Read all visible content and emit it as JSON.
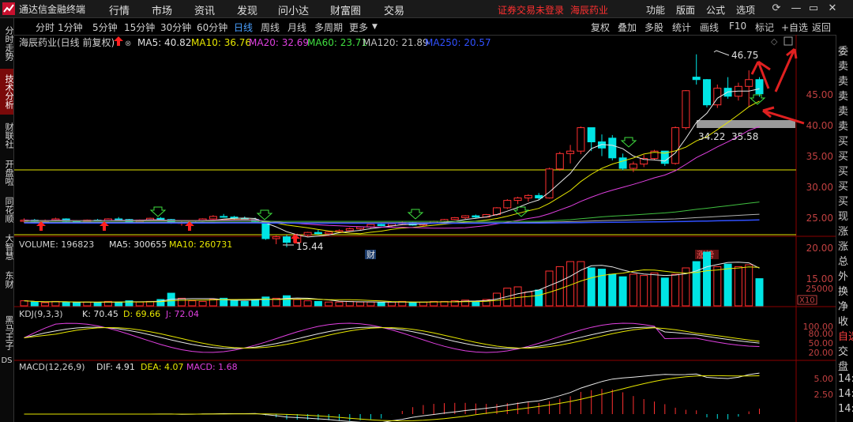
{
  "app": {
    "title": "通达信金融终端"
  },
  "menu": [
    "行情",
    "市场",
    "资讯",
    "发现",
    "问小达",
    "财富圈",
    "交易"
  ],
  "notice": {
    "login": "证券交易未登录",
    "stock": "海辰药业"
  },
  "right_menu": [
    "功能",
    "版面",
    "公式",
    "选项"
  ],
  "left_tabs": [
    "分时走势",
    "技术分析",
    "财联社",
    "开盘啦",
    "同花顺",
    "大智慧",
    "东财",
    "黑马王子",
    "DS"
  ],
  "periods": [
    "分时",
    "1分钟",
    "5分钟",
    "15分钟",
    "30分钟",
    "60分钟",
    "日线",
    "周线",
    "月线",
    "多周期",
    "更多"
  ],
  "selected_period": "日线",
  "tools": [
    "复权",
    "叠加",
    "多股",
    "统计",
    "画线",
    "F10",
    "标记",
    "+自选",
    "返回"
  ],
  "stock_header": {
    "name": "海辰药业(日线 前复权)",
    "ma5": "MA5: 40.82",
    "ma10": "MA10: 36.76",
    "ma20": "MA20: 32.69",
    "ma60": "MA60: 23.71",
    "ma120": "MA120: 21.89",
    "ma250": "MA250: 20.57"
  },
  "price_axis": [
    "45.00",
    "40.00",
    "35.00",
    "30.00",
    "25.00",
    "20.00",
    "15.00"
  ],
  "annotations": {
    "high": "46.75",
    "low": "15.44",
    "range_low": "34.22",
    "range_high": "35.58",
    "cai": "财",
    "zhangbang": "涨榜"
  },
  "volume_header": {
    "volume": "VOLUME: 196823",
    "ma5": "MA5: 300655",
    "ma10": "MA10: 260731"
  },
  "volume_axis": {
    "value": "25000",
    "unit": "X10"
  },
  "kdj_header": {
    "name": "KDJ(9,3,3)",
    "k": "K: 70.45",
    "d": "D: 69.66",
    "j": "J: 72.04"
  },
  "kdj_axis": [
    "100.00",
    "80.00",
    "50.00",
    "20.00"
  ],
  "macd_header": {
    "name": "MACD(12,26,9)",
    "dif": "DIF: 4.91",
    "dea": "DEA: 4.07",
    "macd": "MACD: 1.68"
  },
  "macd_axis": [
    "5.00",
    "2.50"
  ],
  "right_panel": [
    "委",
    "卖",
    "卖",
    "卖",
    "卖",
    "卖",
    "买",
    "买",
    "买",
    "买",
    "买",
    "现",
    "涨",
    "涨",
    "总",
    "外",
    "换",
    "净",
    "收",
    "自选",
    "交",
    "盘",
    "14:",
    "14:",
    "14:"
  ],
  "candles": [
    [
      19.6,
      20.1,
      19.4,
      19.8
    ],
    [
      19.8,
      20.0,
      19.5,
      19.6
    ],
    [
      19.6,
      19.9,
      19.4,
      19.7
    ],
    [
      19.7,
      20.2,
      19.6,
      20.0
    ],
    [
      20.0,
      20.1,
      19.5,
      19.6
    ],
    [
      19.6,
      19.8,
      19.3,
      19.5
    ],
    [
      19.5,
      19.9,
      19.4,
      19.8
    ],
    [
      19.8,
      20.0,
      19.6,
      19.7
    ],
    [
      19.7,
      20.1,
      19.6,
      20.0
    ],
    [
      20.0,
      20.3,
      19.8,
      19.9
    ],
    [
      19.9,
      20.0,
      19.4,
      19.5
    ],
    [
      19.5,
      19.9,
      19.3,
      19.8
    ],
    [
      19.8,
      20.2,
      19.7,
      20.1
    ],
    [
      20.1,
      20.3,
      19.8,
      19.9
    ],
    [
      19.9,
      20.0,
      19.2,
      19.3
    ],
    [
      19.3,
      19.6,
      18.9,
      19.4
    ],
    [
      19.4,
      19.8,
      19.2,
      19.7
    ],
    [
      19.7,
      20.1,
      19.6,
      20.0
    ],
    [
      20.0,
      20.6,
      19.9,
      20.4
    ],
    [
      20.4,
      20.8,
      20.2,
      20.3
    ],
    [
      20.3,
      20.5,
      19.9,
      20.1
    ],
    [
      20.1,
      20.4,
      19.8,
      19.9
    ],
    [
      19.9,
      20.2,
      19.5,
      19.6
    ],
    [
      19.6,
      19.7,
      16.6,
      16.8
    ],
    [
      16.8,
      17.3,
      15.9,
      17.1
    ],
    [
      17.1,
      17.4,
      15.4,
      16.2
    ],
    [
      16.2,
      17.6,
      16.0,
      17.4
    ],
    [
      17.4,
      17.9,
      17.2,
      17.8
    ],
    [
      17.8,
      18.2,
      17.5,
      17.6
    ],
    [
      17.6,
      18.0,
      17.3,
      17.9
    ],
    [
      17.9,
      18.3,
      17.7,
      18.1
    ],
    [
      18.1,
      18.6,
      17.9,
      18.4
    ],
    [
      18.4,
      18.8,
      18.2,
      18.7
    ],
    [
      18.7,
      19.2,
      18.5,
      19.1
    ],
    [
      19.1,
      19.4,
      18.8,
      18.9
    ],
    [
      18.9,
      19.3,
      18.7,
      19.2
    ],
    [
      19.2,
      19.6,
      19.0,
      19.4
    ],
    [
      19.4,
      19.5,
      18.9,
      19.0
    ],
    [
      19.0,
      19.4,
      18.8,
      19.3
    ],
    [
      19.3,
      19.7,
      19.2,
      19.6
    ],
    [
      19.6,
      20.0,
      19.4,
      19.9
    ],
    [
      19.9,
      20.3,
      19.8,
      20.2
    ],
    [
      20.2,
      20.6,
      20.0,
      20.5
    ],
    [
      20.5,
      20.7,
      20.1,
      20.3
    ],
    [
      20.3,
      20.8,
      20.2,
      20.7
    ],
    [
      20.7,
      21.9,
      20.5,
      21.8
    ],
    [
      21.8,
      23.2,
      21.6,
      23.0
    ],
    [
      23.0,
      23.6,
      22.4,
      23.4
    ],
    [
      23.4,
      24.0,
      22.8,
      23.8
    ],
    [
      23.8,
      24.2,
      23.1,
      23.4
    ],
    [
      23.4,
      28.3,
      23.3,
      28.1
    ],
    [
      28.1,
      30.9,
      27.8,
      30.6
    ],
    [
      30.6,
      32.0,
      29.0,
      31.0
    ],
    [
      31.0,
      35.0,
      30.5,
      34.8
    ],
    [
      34.8,
      33.8,
      31.0,
      32.5
    ],
    [
      32.5,
      33.7,
      30.2,
      31.5
    ],
    [
      33.1,
      33.6,
      29.5,
      29.9
    ],
    [
      29.9,
      30.6,
      27.9,
      28.2
    ],
    [
      28.2,
      29.3,
      27.6,
      28.9
    ],
    [
      28.9,
      30.4,
      28.4,
      29.8
    ],
    [
      29.8,
      31.2,
      29.5,
      31.0
    ],
    [
      31.0,
      30.6,
      28.6,
      29.0
    ],
    [
      29.0,
      35.0,
      28.8,
      34.8
    ],
    [
      34.8,
      40.9,
      34.5,
      40.8
    ],
    [
      43.0,
      46.7,
      41.8,
      42.6
    ],
    [
      42.6,
      42.7,
      38.1,
      38.5
    ],
    [
      38.5,
      41.8,
      38.0,
      41.2
    ],
    [
      41.2,
      43.0,
      39.5,
      39.9
    ],
    [
      39.9,
      42.1,
      39.2,
      41.5
    ],
    [
      41.5,
      44.1,
      38.2,
      42.6
    ],
    [
      42.6,
      43.0,
      39.8,
      40.3
    ]
  ],
  "volume_ratio": [
    0.08,
    0.06,
    0.05,
    0.07,
    0.06,
    0.05,
    0.06,
    0.05,
    0.07,
    0.06,
    0.08,
    0.06,
    0.07,
    0.1,
    0.2,
    0.12,
    0.08,
    0.07,
    0.1,
    0.12,
    0.08,
    0.07,
    0.1,
    0.14,
    0.12,
    0.16,
    0.1,
    0.08,
    0.07,
    0.06,
    0.06,
    0.07,
    0.06,
    0.06,
    0.05,
    0.06,
    0.07,
    0.05,
    0.06,
    0.07,
    0.07,
    0.08,
    0.09,
    0.07,
    0.1,
    0.2,
    0.28,
    0.3,
    0.22,
    0.25,
    0.55,
    0.62,
    0.7,
    0.7,
    0.6,
    0.58,
    0.5,
    0.46,
    0.5,
    0.48,
    0.52,
    0.44,
    0.5,
    0.6,
    0.7,
    0.85,
    0.62,
    0.66,
    0.62,
    0.65,
    0.43
  ]
}
